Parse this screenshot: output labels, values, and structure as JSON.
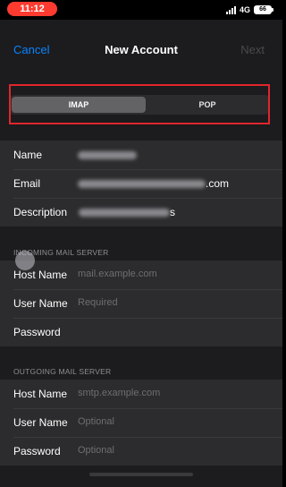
{
  "status_bar": {
    "time": "11:12",
    "network": "4G",
    "battery": "66"
  },
  "nav": {
    "cancel": "Cancel",
    "title": "New Account",
    "next": "Next"
  },
  "segmented": {
    "options": [
      "IMAP",
      "POP"
    ],
    "selected": "IMAP"
  },
  "account": {
    "name_label": "Name",
    "email_label": "Email",
    "email_suffix": ".com",
    "description_label": "Description",
    "description_suffix": "s"
  },
  "incoming": {
    "header": "INCOMING MAIL SERVER",
    "host_label": "Host Name",
    "host_placeholder": "mail.example.com",
    "user_label": "User Name",
    "user_placeholder": "Required",
    "password_label": "Password"
  },
  "outgoing": {
    "header": "OUTGOING MAIL SERVER",
    "host_label": "Host Name",
    "host_placeholder": "smtp.example.com",
    "user_label": "User Name",
    "user_placeholder": "Optional",
    "password_label": "Password",
    "password_placeholder": "Optional"
  },
  "colors": {
    "accent": "#0a84ff",
    "highlight": "#e0262c",
    "time_pill": "#ff3b30"
  }
}
